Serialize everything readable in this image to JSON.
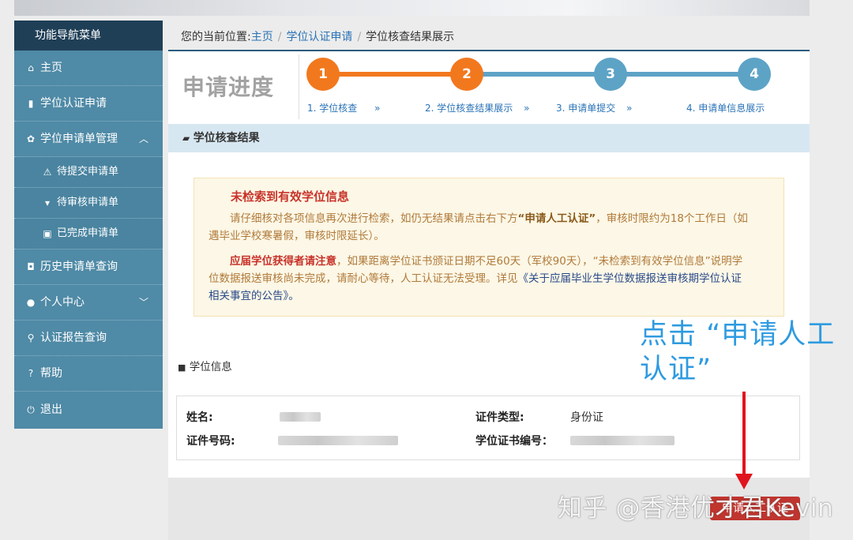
{
  "sidebar": {
    "header": "功能导航菜单",
    "items": [
      {
        "label": "主页",
        "icon": "home-icon"
      },
      {
        "label": "学位认证申请",
        "icon": "file-icon"
      },
      {
        "label": "学位申请单管理",
        "icon": "gear-icon",
        "arrow": "chevron-up-icon"
      },
      {
        "label": "待提交申请单",
        "icon": "warning-icon"
      },
      {
        "label": "待审核申请单",
        "icon": "cart-icon"
      },
      {
        "label": "已完成申请单",
        "icon": "briefcase-icon"
      },
      {
        "label": "历史申请单查询",
        "icon": "camera-icon"
      },
      {
        "label": "个人中心",
        "icon": "user-icon",
        "arrow": "chevron-down-icon"
      },
      {
        "label": "认证报告查询",
        "icon": "search-icon"
      },
      {
        "label": "帮助",
        "icon": "question-icon"
      },
      {
        "label": "退出",
        "icon": "power-icon"
      }
    ]
  },
  "breadcrumb": {
    "prefix": "您的当前位置:",
    "home": "主页",
    "level1": "学位认证申请",
    "current": "学位核查结果展示",
    "separator": "/"
  },
  "progress": {
    "title": "申请进度",
    "active_color": "#f2781e",
    "inactive_color": "#5da3c6",
    "steps": [
      {
        "num": "1",
        "label": "1. 学位核查",
        "arrow": "»"
      },
      {
        "num": "2",
        "label": "2. 学位核查结果展示",
        "arrow": "»"
      },
      {
        "num": "3",
        "label": "3. 申请单提交",
        "arrow": "»"
      },
      {
        "num": "4",
        "label": "4. 申请单信息展示",
        "arrow": ""
      }
    ]
  },
  "result_section": {
    "title": "学位核查结果",
    "icon": "comment-icon"
  },
  "notice": {
    "title": "未检索到有效学位信息",
    "p1_a": "请仔细核对各项信息再次进行检索，如仍无结果请点击右下方",
    "p1_b": "“申请人工认证”",
    "p1_c": "，审核时限约为18个工作日（如遇毕业学校寒暑假，审核时限延长）。",
    "p2_a": "应届学位获得者请注意",
    "p2_b": "，如果距离学位证书颁证日期不足60天（军校90天），“未检索到有效学位信息”说明学位数据报送审核尚未完成，请耐心等待，人工认证无法受理。详见",
    "p2_c": "《关于应届毕业生学位数据报送审核期学位认证相关事宜的公告》",
    "p2_d": "。"
  },
  "degree_info": {
    "title": "学位信息",
    "icon": "video-icon",
    "name_label": "姓名:",
    "id_type_label": "证件类型:",
    "id_type_value": "身份证",
    "id_number_label": "证件号码:",
    "cert_number_label": "学位证书编号："
  },
  "footer": {
    "button_label": "申请人工认证"
  },
  "annotation": {
    "text": "点击 “申请人工认证”"
  },
  "watermark": {
    "text": "知乎 @香港优才君Kevin"
  }
}
